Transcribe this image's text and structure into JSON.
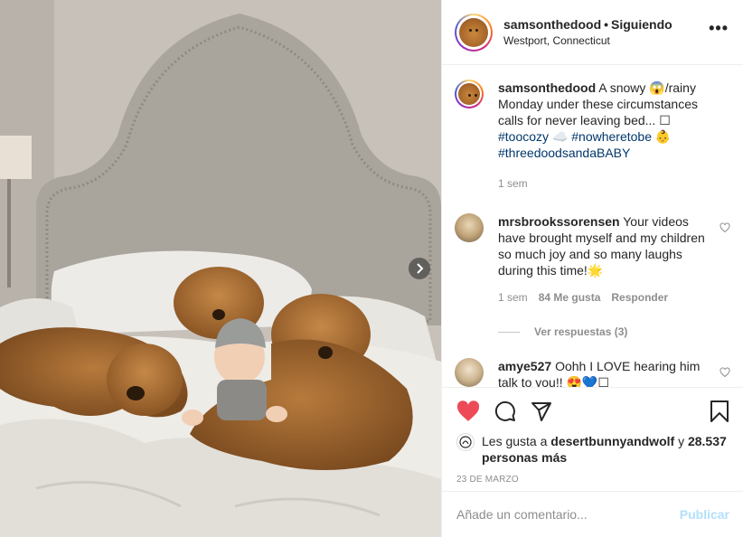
{
  "post": {
    "username": "samsonthedood",
    "separator": "•",
    "follow_status": "Siguiendo",
    "location": "Westport, Connecticut",
    "more_label": "•••"
  },
  "caption": {
    "username": "samsonthedood",
    "text_1": "A snowy 😱/rainy Monday under these circumstances calls for never leaving bed... ☐",
    "tag_1": "#toocozy",
    "text_2": "☁️",
    "tag_2": "#nowheretobe",
    "text_3": "👶",
    "tag_3": "#threedoodsandaBABY",
    "time": "1 sem"
  },
  "comments": [
    {
      "username": "mrsbrookssorensen",
      "text": "Your videos have brought myself and my children so much joy and so many laughs during this time!🌟",
      "time": "1 sem",
      "likes": "84 Me gusta",
      "reply": "Responder",
      "view_replies": "Ver respuestas (3)"
    },
    {
      "username": "amye527",
      "text": "Oohh I LOVE hearing him talk to you!! 😍💙☐"
    }
  ],
  "likes": {
    "prefix": "Les gusta a",
    "user": "desertbunnyandwolf",
    "conj": "y",
    "count": "28.537 personas más"
  },
  "date": "23 DE MARZO",
  "comment_box": {
    "placeholder": "Añade un comentario...",
    "publish": "Publicar"
  },
  "colors": {
    "like_red": "#ed4956",
    "link_blue": "#00376b",
    "publish_disabled": "#b2dffc",
    "muted": "#8e8e8e"
  },
  "icons": [
    "heart-filled-icon",
    "comment-icon",
    "share-icon",
    "bookmark-icon",
    "chevron-right-icon",
    "more-icon",
    "heart-outline-icon"
  ]
}
